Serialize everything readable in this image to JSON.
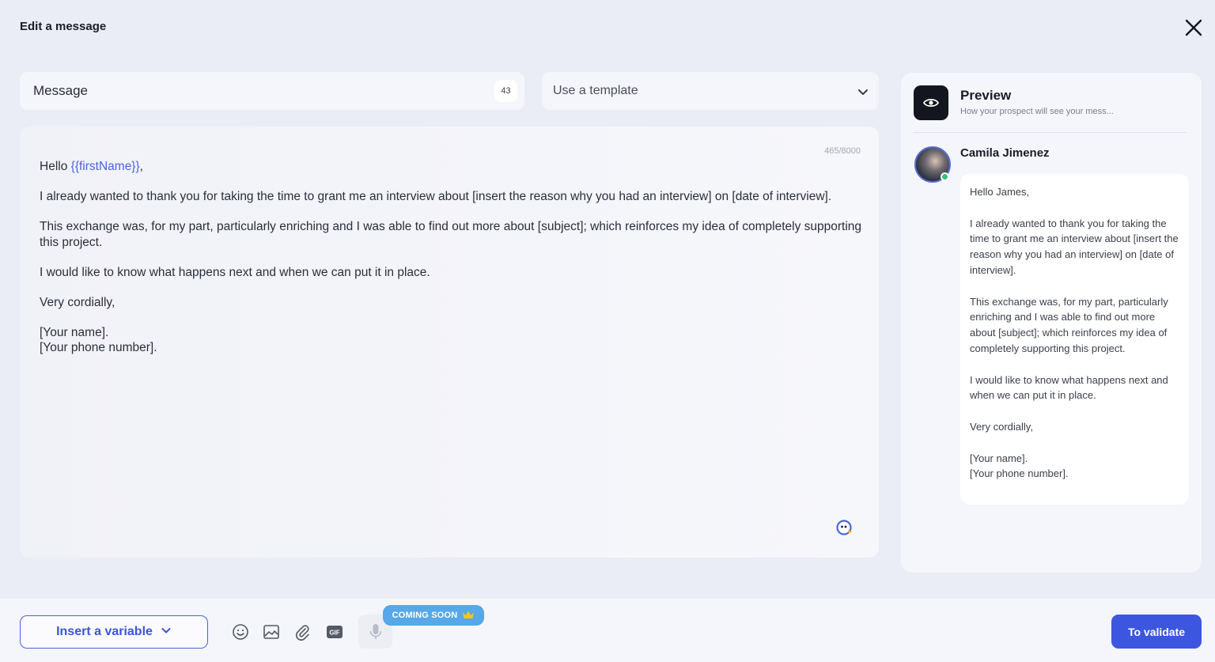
{
  "header": {
    "title": "Edit a message"
  },
  "message_field": {
    "label": "Message",
    "count": "43"
  },
  "template_select": {
    "label": "Use a template"
  },
  "editor": {
    "char_counter": "465/8000",
    "greeting_prefix": "Hello ",
    "greeting_variable": "{{firstName}}",
    "greeting_suffix": ",",
    "paragraphs": [
      "I already wanted to thank you for taking the time to grant me an interview about [insert the reason why you had an interview] on [date of interview].",
      "This exchange was, for my part, particularly enriching and I was able to find out more about [subject]; which reinforces my idea of completely supporting this project.",
      "I would like to know what happens next and when we can put it in place.",
      "Very cordially,"
    ],
    "signature_lines": [
      "[Your name].",
      "[Your phone number]."
    ]
  },
  "preview": {
    "title": "Preview",
    "subtitle": "How your prospect will see your mess...",
    "contact_name": "Camila Jimenez",
    "bubble": {
      "greeting": "Hello James,",
      "paragraphs": [
        "I already wanted to thank you for taking the time to grant me an interview about [insert the reason why you had an interview] on [date of interview].",
        "This exchange was, for my part, particularly enriching and I was able to find out more about [subject]; which reinforces my idea of completely supporting this project.",
        "I would like to know what happens next and when we can put it in place.",
        "Very cordially,"
      ],
      "signature_lines": [
        "[Your name].",
        "[Your phone number]."
      ]
    }
  },
  "toolbar": {
    "insert_variable_label": "Insert a variable",
    "coming_soon_label": "COMING SOON",
    "validate_label": "To validate",
    "icons": [
      "emoji-icon",
      "image-icon",
      "attachment-icon",
      "gif-icon",
      "microphone-icon"
    ]
  },
  "colors": {
    "accent": "#3d56e0",
    "variable": "#4a62e0",
    "badge": "#56a8e8",
    "online": "#2fc27a"
  }
}
